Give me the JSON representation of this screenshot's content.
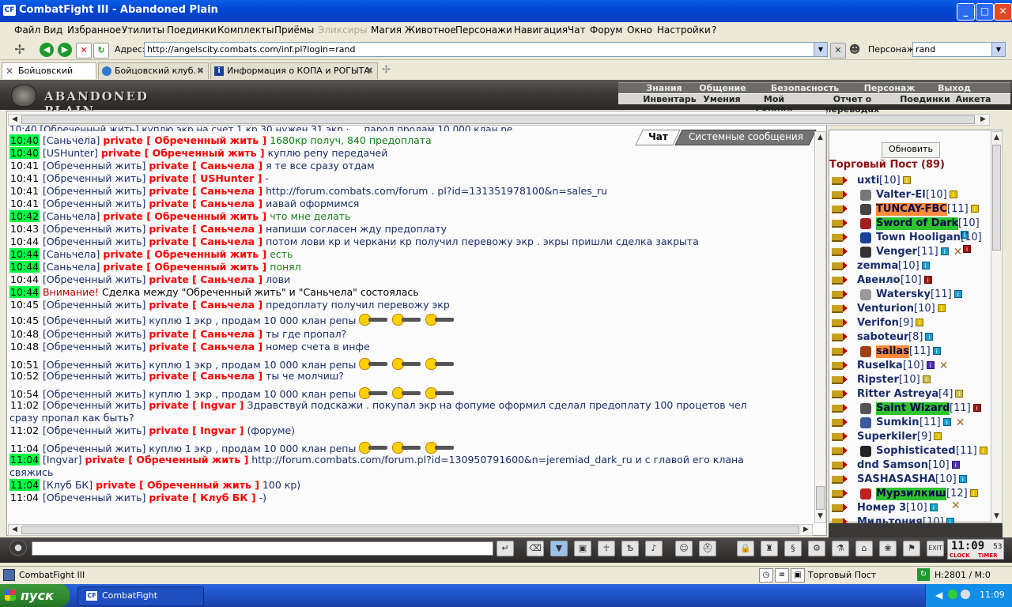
{
  "window": {
    "title": "CombatFight III - Abandoned Plain",
    "icon_label": "CF"
  },
  "menu": [
    {
      "label": "Файл",
      "disabled": false
    },
    {
      "label": "Вид",
      "disabled": false
    },
    {
      "label": "Избранное",
      "disabled": false
    },
    {
      "label": "Утилиты",
      "disabled": false
    },
    {
      "label": "Поединки",
      "disabled": false
    },
    {
      "label": "Комплекты",
      "disabled": false
    },
    {
      "label": "Приёмы",
      "disabled": false
    },
    {
      "label": "Эликсиры",
      "disabled": true
    },
    {
      "label": "Магия",
      "disabled": false
    },
    {
      "label": "Животное",
      "disabled": false
    },
    {
      "label": "Персонажи",
      "disabled": false
    },
    {
      "label": "Навигация",
      "disabled": false
    },
    {
      "label": "Чат",
      "disabled": false
    },
    {
      "label": "Форум",
      "disabled": false
    },
    {
      "label": "Окно",
      "disabled": false
    },
    {
      "label": "Настройки",
      "disabled": false
    },
    {
      "label": "?",
      "disabled": false
    }
  ],
  "address": {
    "label": "Адрес:",
    "url": "http://angelscity.combats.com/inf.pl?login=rand",
    "char_label": "Персонаж:",
    "char_value": "rand"
  },
  "tabs": [
    {
      "label": "Бойцовский клуб",
      "active": true
    },
    {
      "label": "Бойцовский клуб.",
      "active": false
    },
    {
      "label": "Информация о КОПА и РОГЫТА",
      "active": false
    }
  ],
  "game": {
    "logo_text": "ABANDONED PLAIN",
    "nav1": [
      "Знания",
      "Общение",
      "Безопасность",
      "Персонаж",
      "Выход"
    ],
    "nav2": [
      "Инвентарь",
      "Умения",
      "Мой Скролл",
      "Отчет о переводах",
      "Поединки",
      "Анкета"
    ]
  },
  "chat_tabs": {
    "chat": "Чат",
    "system": "Системные сообщения"
  },
  "chat_top_partial": "10:40 [Обреченный жить] куплю экр на счет 1 кр 30 нужен 31 экр · ... парол продам 10 000 клан ре...",
  "chat": [
    {
      "time": "10:40",
      "hl": true,
      "sender": "[Саньчела]",
      "private": "private [ Обреченный жить ]",
      "msg": "1680кр получ, 840 предоплата",
      "green": true,
      "smiles": 0
    },
    {
      "time": "10:40",
      "hl": true,
      "sender": "[USHunter]",
      "private": "private [ Обреченный жить ]",
      "msg": "куплю репу передачей",
      "green": false,
      "smiles": 0
    },
    {
      "time": "10:41",
      "hl": false,
      "sender": "[Обреченный жить]",
      "private": "private [ Саньчела ]",
      "msg": "я те все сразу отдам",
      "green": false,
      "smiles": 0
    },
    {
      "time": "10:41",
      "hl": false,
      "sender": "[Обреченный жить]",
      "private": "private [ USHunter ]",
      "msg": "-",
      "green": false,
      "smiles": 0
    },
    {
      "time": "10:41",
      "hl": false,
      "sender": "[Обреченный жить]",
      "private": "private [ Саньчела ]",
      "msg": "http://forum.combats.com/forum . pl?id=131351978100&n=sales_ru",
      "green": false,
      "smiles": 0
    },
    {
      "time": "10:41",
      "hl": false,
      "sender": "[Обреченный жить]",
      "private": "private [ Саньчела ]",
      "msg": "иавай оформимся",
      "green": false,
      "smiles": 0
    },
    {
      "time": "10:42",
      "hl": true,
      "sender": "[Саньчела]",
      "private": "private [ Обреченный жить ]",
      "msg": "что мне делать",
      "green": true,
      "smiles": 0
    },
    {
      "time": "10:43",
      "hl": false,
      "sender": "[Обреченный жить]",
      "private": "private [ Саньчела ]",
      "msg": "напиши согласен жду предоплату",
      "green": false,
      "smiles": 0
    },
    {
      "time": "10:44",
      "hl": false,
      "sender": "[Обреченный жить]",
      "private": "private [ Саньчела ]",
      "msg": "потом лови кр и черкани кр получил перевожу экр . экры пришли сделка закрыта",
      "green": false,
      "smiles": 0
    },
    {
      "time": "10:44",
      "hl": true,
      "sender": "[Саньчела]",
      "private": "private [ Обреченный жить ]",
      "msg": "есть",
      "green": true,
      "smiles": 0
    },
    {
      "time": "10:44",
      "hl": true,
      "sender": "[Саньчела]",
      "private": "private [ Обреченный жить ]",
      "msg": "понял",
      "green": true,
      "smiles": 0
    },
    {
      "time": "10:44",
      "hl": false,
      "sender": "[Обреченный жить]",
      "private": "private [ Саньчела ]",
      "msg": "лови",
      "green": false,
      "smiles": 0
    },
    {
      "time": "10:44",
      "hl": true,
      "warning": "Внимание!",
      "msg": "Сделка между \"Обреченный жить\" и \"Саньчела\" состоялась"
    },
    {
      "time": "10:45",
      "hl": false,
      "sender": "[Обреченный жить]",
      "private": "private [ Саньчела ]",
      "msg": "предоплату получил перевожу экр",
      "green": false,
      "smiles": 0
    },
    {
      "time": "10:45",
      "hl": false,
      "sender": "[Обреченный жить]",
      "private": "",
      "msg": "куплю 1 экр , продам 10 000 клан репы",
      "green": false,
      "smiles": 3
    },
    {
      "time": "10:48",
      "hl": false,
      "sender": "[Обреченный жить]",
      "private": "private [ Саньчела ]",
      "msg": "ты где пропал?",
      "green": false,
      "smiles": 0
    },
    {
      "time": "10:48",
      "hl": false,
      "sender": "[Обреченный жить]",
      "private": "private [ Саньчела ]",
      "msg": "номер счета в инфе",
      "green": false,
      "smiles": 0
    },
    {
      "time": "10:51",
      "hl": false,
      "sender": "[Обреченный жить]",
      "private": "",
      "msg": "куплю 1 экр , продам 10 000 клан репы",
      "green": false,
      "smiles": 3
    },
    {
      "time": "10:52",
      "hl": false,
      "sender": "[Обреченный жить]",
      "private": "private [ Саньчела ]",
      "msg": "ты че молчиш?",
      "green": false,
      "smiles": 0
    },
    {
      "time": "10:54",
      "hl": false,
      "sender": "[Обреченный жить]",
      "private": "",
      "msg": "куплю 1 экр , продам 10 000 клан репы",
      "green": false,
      "smiles": 3
    },
    {
      "time": "11:02",
      "hl": false,
      "sender": "[Обреченный жить]",
      "private": "private [ Ingvar ]",
      "msg": "Здравствуй подскажи . покупал экр на фопуме оформил сделал предоплату 100 процетов чел",
      "cont": "сразу пропал как быть?",
      "green": false,
      "smiles": 0
    },
    {
      "time": "11:02",
      "hl": false,
      "sender": "[Обреченный жить]",
      "private": "private [ Ingvar ]",
      "msg": "(форуме)",
      "green": false,
      "smiles": 0
    },
    {
      "time": "11:04",
      "hl": false,
      "sender": "[Обреченный жить]",
      "private": "",
      "msg": "куплю 1 экр , продам 10 000 клан репы",
      "green": false,
      "smiles": 3
    },
    {
      "time": "11:04",
      "hl": true,
      "sender": "[Ingvar]",
      "private": "private [ Обреченный жить ]",
      "msg": "http://forum.combats.com/forum.pl?id=130950791600&n=jeremiad_dark_ru и с главой его клана",
      "cont": "свяжись",
      "green": false,
      "smiles": 0
    },
    {
      "time": "11:04",
      "hl": true,
      "sender": "[Клуб БК]",
      "private": "private [ Обреченный жить ]",
      "msg": "100 кр)",
      "green": false,
      "smiles": 0
    },
    {
      "time": "11:04",
      "hl": false,
      "sender": "[Обреченный жить]",
      "private": "private [ Клуб БК ]",
      "msg": "-)",
      "green": false,
      "smiles": 0
    }
  ],
  "right": {
    "refresh": "Обновить",
    "title": "Торговый Пост (89)",
    "users": [
      {
        "name": "uxti",
        "level": "[10]",
        "style": "",
        "info": "",
        "x": false,
        "clan": ""
      },
      {
        "name": "Valter-El",
        "level": "[10]",
        "style": "",
        "info": "",
        "x": false,
        "clan": "#777"
      },
      {
        "name": "TUNCAY-FBC",
        "level": "[11]",
        "style": "or",
        "info": "",
        "x": false,
        "clan": "#444"
      },
      {
        "name": "Sword of Dark",
        "level": "[10]",
        "style": "gr",
        "info": "bl",
        "x": false,
        "clan": "#a02020"
      },
      {
        "name": "Town Hooligan",
        "level": "[10]",
        "style": "",
        "info": "rd",
        "x": false,
        "clan": "#1a3f9a"
      },
      {
        "name": "Venger",
        "level": "[11]",
        "style": "",
        "info": "bl",
        "x": true,
        "clan": "#333"
      },
      {
        "name": "zemma",
        "level": "[10]",
        "style": "",
        "info": "bl",
        "x": false,
        "clan": ""
      },
      {
        "name": "Авенло",
        "level": "[10]",
        "style": "",
        "info": "rd",
        "x": false,
        "clan": ""
      },
      {
        "name": "Watersky",
        "level": "[11]",
        "style": "",
        "info": "bl",
        "x": false,
        "clan": "#999"
      },
      {
        "name": "Venturion",
        "level": "[10]",
        "style": "",
        "info": "",
        "x": false,
        "clan": ""
      },
      {
        "name": "Verifon",
        "level": "[9]",
        "style": "",
        "info": "",
        "x": false,
        "clan": ""
      },
      {
        "name": "saboteur",
        "level": "[8]",
        "style": "",
        "info": "bl",
        "x": false,
        "clan": ""
      },
      {
        "name": "sailas",
        "level": "[11]",
        "style": "or",
        "info": "bl",
        "x": false,
        "clan": "#a04010"
      },
      {
        "name": "Ruselka",
        "level": "[10]",
        "style": "",
        "info": "pu",
        "x": true,
        "clan": ""
      },
      {
        "name": "Ripster",
        "level": "[10]",
        "style": "",
        "info": "gy",
        "x": false,
        "clan": ""
      },
      {
        "name": "Ritter Astreya",
        "level": "[4]",
        "style": "",
        "info": "gy",
        "x": false,
        "clan": ""
      },
      {
        "name": "Saint Wizard",
        "level": "[11]",
        "style": "gr",
        "info": "rd",
        "x": false,
        "clan": "#555"
      },
      {
        "name": "Sumkin",
        "level": "[11]",
        "style": "",
        "info": "bl",
        "x": true,
        "clan": "#3a5a9a"
      },
      {
        "name": "Superkiler",
        "level": "[9]",
        "style": "",
        "info": "",
        "x": false,
        "clan": ""
      },
      {
        "name": "Sophisticated",
        "level": "[11]",
        "style": "",
        "info": "",
        "x": false,
        "clan": "#222"
      },
      {
        "name": "dnd Samson",
        "level": "[10]",
        "style": "",
        "info": "pu",
        "x": false,
        "clan": ""
      },
      {
        "name": "SASHASASHA",
        "level": "[10]",
        "style": "",
        "info": "bl",
        "x": false,
        "clan": ""
      },
      {
        "name": "Мурзилкиш",
        "level": "[12]",
        "style": "gr",
        "info": "",
        "x": true,
        "clan": "#c02020"
      },
      {
        "name": "Номер 3",
        "level": "[10]",
        "style": "",
        "info": "bl",
        "x": false,
        "clan": ""
      },
      {
        "name": "Мильтония",
        "level": "[10]",
        "style": "",
        "info": "bl",
        "x": false,
        "clan": ""
      }
    ]
  },
  "clock": {
    "time": "11:09",
    "sec": "53",
    "clock_label": "CLOCK",
    "timer_label": "TIMER"
  },
  "status": {
    "left": "CombatFight III",
    "post": "Торговый Пост",
    "hp": "H:2801 / M:0"
  },
  "taskbar": {
    "start": "пуск",
    "item": "CombatFight",
    "time": "11:09"
  }
}
